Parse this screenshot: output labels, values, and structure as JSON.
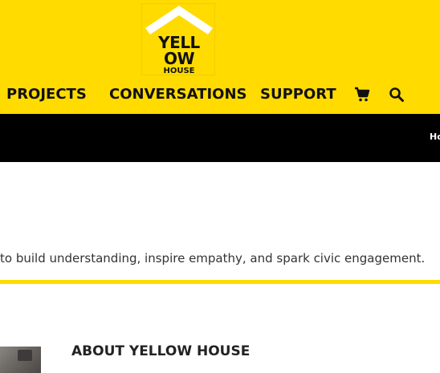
{
  "header": {
    "logo": {
      "line1": "YELL",
      "line2": "OW",
      "line3": "HOUSE"
    },
    "nav": [
      {
        "label": "PROJECTS"
      },
      {
        "label": "CONVERSATIONS"
      },
      {
        "label": "SUPPORT"
      }
    ],
    "icons": [
      "cart-icon",
      "search-icon"
    ]
  },
  "breadcrumb": {
    "text": "Ho"
  },
  "content": {
    "mission_text": "to build understanding, inspire empathy, and spark civic engagement.",
    "about_heading": "ABOUT YELLOW HOUSE"
  },
  "colors": {
    "brand_yellow": "#FFDB00",
    "bar_black": "#000000",
    "text_dark": "#111111"
  }
}
